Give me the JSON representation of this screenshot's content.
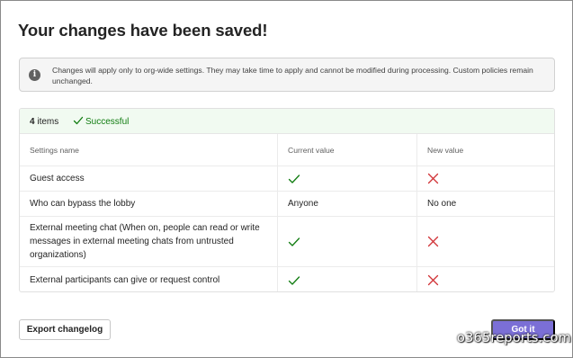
{
  "dialog": {
    "title": "Your changes have been saved!"
  },
  "info": {
    "icon": "info-icon",
    "glyph": "i",
    "text": "Changes will apply only to org-wide settings. They may take time to apply and cannot be modified during processing. Custom policies remain unchanged."
  },
  "summary": {
    "count": "4",
    "count_suffix": " items",
    "status": "Successful",
    "status_color": "#107c10"
  },
  "table": {
    "columns": [
      "Settings name",
      "Current value",
      "New value"
    ],
    "rows": [
      {
        "name": "Guest access",
        "current": "check",
        "new": "cross"
      },
      {
        "name": "Who can bypass the lobby",
        "current": "Anyone",
        "new": "No one"
      },
      {
        "name": "External meeting chat (When on, people can read or write messages in external meeting chats from untrusted organizations)",
        "current": "check",
        "new": "cross"
      },
      {
        "name": "External participants can give or request control",
        "current": "check",
        "new": "cross"
      }
    ]
  },
  "colors": {
    "check": "#107c10",
    "cross": "#d13438",
    "primary_button": "#7b6fd6"
  },
  "footer": {
    "export_label": "Export changelog",
    "got_it_label": "Got it"
  },
  "watermark": "o365reports.com"
}
